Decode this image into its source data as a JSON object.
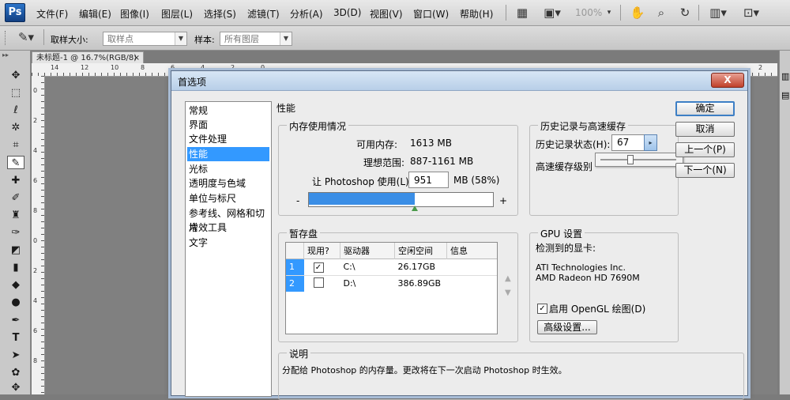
{
  "app": {
    "logo": "Ps"
  },
  "menu": [
    "文件(F)",
    "编辑(E)",
    "图像(I)",
    "图层(L)",
    "选择(S)",
    "滤镜(T)",
    "分析(A)",
    "3D(D)",
    "视图(V)",
    "窗口(W)",
    "帮助(H)"
  ],
  "menubar_extras": {
    "zoom": "100%"
  },
  "options_bar": {
    "sample_size_label": "取样大小:",
    "sample_size_value": "取样点",
    "sample_label": "样本:",
    "sample_value": "所有图层"
  },
  "document": {
    "tab_title": "未标题-1 @ 16.7%(RGB/8)",
    "ruler_top": [
      "14",
      "12",
      "10",
      "8",
      "6",
      "4",
      "2",
      "0",
      "2"
    ],
    "ruler_left": [
      "0",
      "2",
      "4",
      "6",
      "8",
      "0",
      "2",
      "4",
      "6",
      "8"
    ]
  },
  "dialog": {
    "title": "首选项",
    "close": "X",
    "nav_items": [
      "常规",
      "界面",
      "文件处理",
      "性能",
      "光标",
      "透明度与色域",
      "单位与标尺",
      "参考线、网格和切片",
      "增效工具",
      "文字"
    ],
    "selected_nav_index": 3,
    "section_title": "性能",
    "memory": {
      "title": "内存使用情况",
      "available_label": "可用内存:",
      "available_value": "1613 MB",
      "ideal_label": "理想范围:",
      "ideal_value": "887-1161 MB",
      "let_label": "让 Photoshop 使用(L):",
      "let_value": "951",
      "unit_pct": "MB (58%)",
      "minus": "-",
      "plus": "+",
      "fill_percent": 58,
      "accent": "#3a8ee6"
    },
    "history": {
      "title": "历史记录与高速缓存",
      "states_label": "历史记录状态(H):",
      "states_value": "67",
      "cache_label": "高速缓存级别"
    },
    "scratch": {
      "title": "暂存盘",
      "headers": [
        "现用?",
        "驱动器",
        "空闲空间",
        "信息"
      ],
      "rows": [
        {
          "num": "1",
          "checked": "✓",
          "drive": "C:\\",
          "free": "26.17GB",
          "info": ""
        },
        {
          "num": "2",
          "checked": "",
          "drive": "D:\\",
          "free": "386.89GB",
          "info": ""
        }
      ]
    },
    "gpu": {
      "title": "GPU 设置",
      "detected_label": "检测到的显卡:",
      "card_line1": "ATI Technologies Inc.",
      "card_line2": "AMD Radeon HD 7690M",
      "opengl_label": "启用 OpenGL 绘图(D)",
      "opengl_checked": "✓",
      "advanced_button": "高级设置..."
    },
    "description": {
      "title": "说明",
      "text": "分配给 Photoshop 的内存量。更改将在下一次启动 Photoshop 时生效。"
    },
    "buttons": {
      "ok": "确定",
      "cancel": "取消",
      "prev": "上一个(P)",
      "next": "下一个(N)"
    }
  }
}
